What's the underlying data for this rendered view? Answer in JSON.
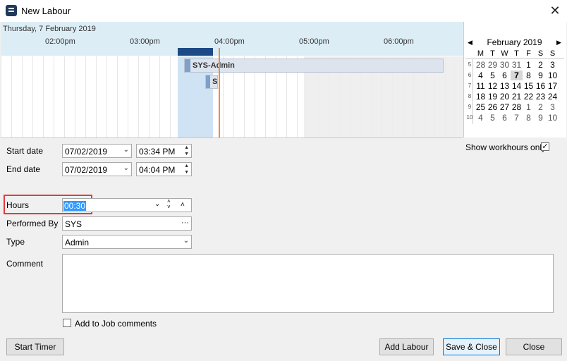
{
  "window": {
    "title": "New Labour",
    "close_label": "✕"
  },
  "scheduler": {
    "date_header": "Thursday, 7 February 2019",
    "hours": [
      "02:00pm",
      "03:00pm",
      "04:00pm",
      "05:00pm",
      "06:00pm"
    ],
    "appointments": [
      {
        "label": "SYS-Admin"
      },
      {
        "label": "S"
      }
    ]
  },
  "calendar": {
    "title": "February 2019",
    "prev_label": "◀",
    "next_label": "▶",
    "weekdays": [
      "M",
      "T",
      "W",
      "T",
      "F",
      "S",
      "S"
    ],
    "weeks": [
      {
        "num": "5",
        "days": [
          "28",
          "29",
          "30",
          "31",
          "1",
          "2",
          "3"
        ]
      },
      {
        "num": "6",
        "days": [
          "4",
          "5",
          "6",
          "7",
          "8",
          "9",
          "10"
        ]
      },
      {
        "num": "7",
        "days": [
          "11",
          "12",
          "13",
          "14",
          "15",
          "16",
          "17"
        ]
      },
      {
        "num": "8",
        "days": [
          "18",
          "19",
          "20",
          "21",
          "22",
          "23",
          "24"
        ]
      },
      {
        "num": "9",
        "days": [
          "25",
          "26",
          "27",
          "28",
          "1",
          "2",
          "3"
        ]
      },
      {
        "num": "10",
        "days": [
          "4",
          "5",
          "6",
          "7",
          "8",
          "9",
          "10"
        ]
      }
    ],
    "selected_day": "7"
  },
  "form": {
    "start_date_label": "Start date",
    "start_date": "07/02/2019",
    "start_time": "03:34 PM",
    "end_date_label": "End date",
    "end_date": "07/02/2019",
    "end_time": "04:04 PM",
    "show_workhours_label": "Show workhours only",
    "show_workhours_checked": true,
    "hours_label": "Hours",
    "hours_value": "00:30",
    "performed_by_label": "Performed By",
    "performed_by_value": "SYS",
    "ellipsis": "···",
    "type_label": "Type",
    "type_value": "Admin",
    "comment_label": "Comment",
    "comment_value": "",
    "add_to_job_comments_label": "Add to Job comments",
    "add_to_job_comments_checked": false
  },
  "buttons": {
    "start_timer": "Start Timer",
    "add_labour": "Add Labour",
    "save_close": "Save & Close",
    "close": "Close"
  }
}
